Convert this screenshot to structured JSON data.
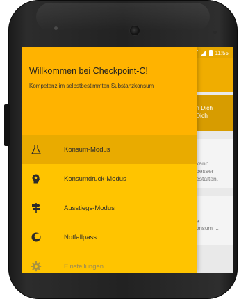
{
  "statusbar": {
    "time": "11:55"
  },
  "drawer": {
    "title": "Willkommen bei Checkpoint-C!",
    "subtitle": "Kompetenz im selbstbestimmten Substanzkonsum",
    "items": [
      {
        "label": "Konsum-Modus",
        "icon": "flask-icon",
        "selected": true
      },
      {
        "label": "Konsumdruck-Modus",
        "icon": "head-icon",
        "selected": false
      },
      {
        "label": "Ausstiegs-Modus",
        "icon": "signpost-icon",
        "selected": false
      },
      {
        "label": "Notfallpass",
        "icon": "moon-icon",
        "selected": false
      },
      {
        "label": "Einstellungen",
        "icon": "gear-icon",
        "selected": false
      }
    ]
  },
  "background": {
    "card1": [
      "n Dich",
      "Dich"
    ],
    "card2": [
      "kann",
      "besser",
      "estalten."
    ],
    "card3": [
      "e",
      "onsum ..."
    ]
  },
  "colors": {
    "drawer": "#ffc400",
    "header": "#ffb300",
    "selected": "#e9ab00",
    "statusbar": "#e6a700"
  }
}
